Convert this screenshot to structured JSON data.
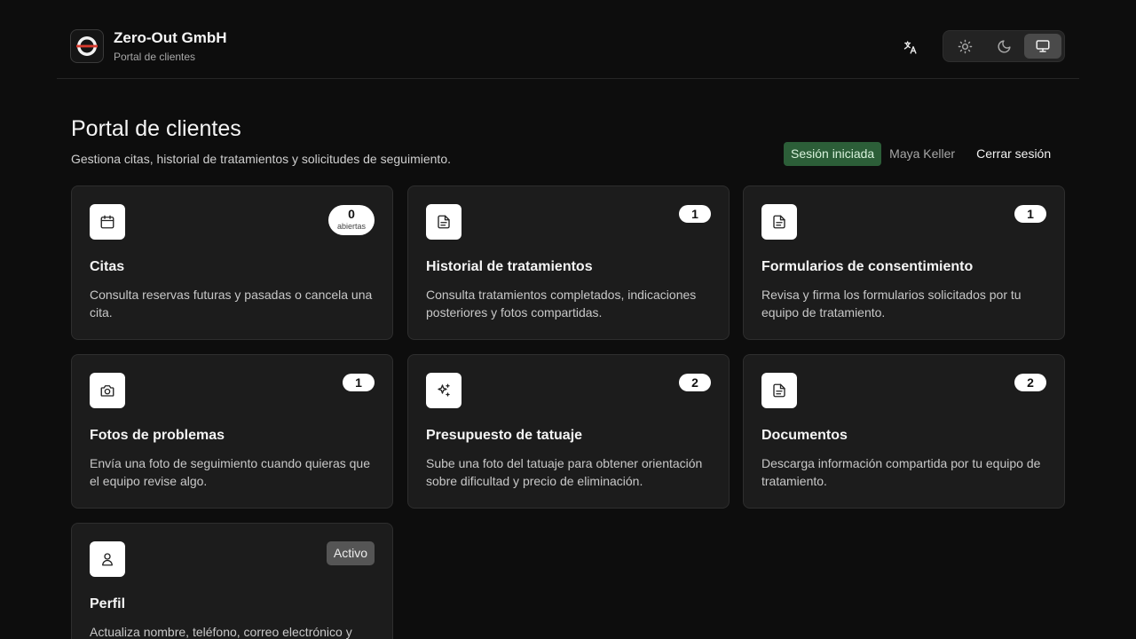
{
  "header": {
    "brand_name": "Zero-Out GmbH",
    "brand_sub": "Portal de clientes",
    "language_icon": "translate-icon",
    "theme_options": [
      {
        "icon": "sun-icon",
        "active": false
      },
      {
        "icon": "moon-icon",
        "active": false
      },
      {
        "icon": "monitor-icon",
        "active": true
      }
    ]
  },
  "page": {
    "title": "Portal de clientes",
    "subtitle": "Gestiona citas, historial de tratamientos y solicitudes de seguimiento."
  },
  "session": {
    "badge": "Sesión iniciada",
    "user": "Maya Keller",
    "logout": "Cerrar sesión"
  },
  "cards": [
    {
      "icon": "calendar-icon",
      "title": "Citas",
      "description": "Consulta reservas futuras y pasadas o cancela una cita.",
      "badge": "0",
      "badge_sub": "abiertas"
    },
    {
      "icon": "document-icon",
      "title": "Historial de tratamientos",
      "description": "Consulta tratamientos completados, indicaciones posteriores y fotos compartidas.",
      "badge": "1"
    },
    {
      "icon": "document-icon",
      "title": "Formularios de consentimiento",
      "description": "Revisa y firma los formularios solicitados por tu equipo de tratamiento.",
      "badge": "1"
    },
    {
      "icon": "camera-icon",
      "title": "Fotos de problemas",
      "description": "Envía una foto de seguimiento cuando quieras que el equipo revise algo.",
      "badge": "1"
    },
    {
      "icon": "sparkles-icon",
      "title": "Presupuesto de tatuaje",
      "description": "Sube una foto del tatuaje para obtener orientación sobre dificultad y precio de eliminación.",
      "badge": "2"
    },
    {
      "icon": "document-icon",
      "title": "Documentos",
      "description": "Descarga información compartida por tu equipo de tratamiento.",
      "badge": "2"
    },
    {
      "icon": "user-icon",
      "title": "Perfil",
      "description": "Actualiza nombre, teléfono, correo electrónico y",
      "badge": "Activo"
    }
  ]
}
